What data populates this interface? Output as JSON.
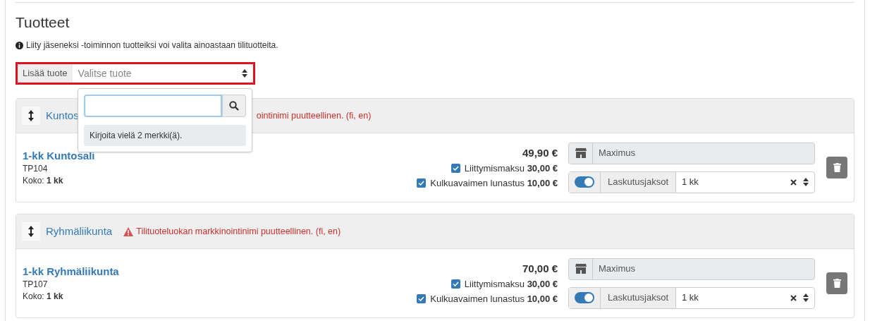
{
  "section": {
    "title": "Tuotteet",
    "info": "Liity jäseneksi -toiminnon tuotteiksi voi valita ainoastaan tilituotteita."
  },
  "add_product": {
    "label": "Lisää tuote",
    "placeholder": "Valitse tuote",
    "highlighted": true
  },
  "dropdown": {
    "message": "Kirjoita vielä 2 merkki(ä)."
  },
  "groups": [
    {
      "kind": "covered",
      "title": "Kuntos",
      "warning_icon": false,
      "warning": "ointinimi puutteellinen. (fi, en)",
      "product": {
        "name": "1-kk Kuntosali",
        "code": "TP104",
        "size": "Koko: **1 kk**",
        "price": "49,90 €",
        "extras": [
          {
            "text": "Liittymismaksu **30,00 €**",
            "checked": true
          },
          {
            "text": "Kulkuavaimen lunastus **10,00 €**",
            "checked": true
          }
        ],
        "location": "Maximus",
        "billing_on": true,
        "billing_label": "Laskutusjaksot",
        "billing_value": "1 kk"
      }
    },
    {
      "kind": "full",
      "title": "Ryhmäliikunta",
      "warning_icon": true,
      "warning": "Tilituoteluokan markkinointinimi puutteellinen. (fi, en)",
      "product": {
        "name": "1-kk Ryhmäliikunta",
        "code": "TP107",
        "size": "Koko: **1 kk**",
        "price": "70,00 €",
        "extras": [
          {
            "text": "Liittymismaksu **30,00 €**",
            "checked": true
          },
          {
            "text": "Kulkuavaimen lunastus **10,00 €**",
            "checked": true
          }
        ],
        "location": "Maximus",
        "billing_on": true,
        "billing_label": "Laskutusjaksot",
        "billing_value": "1 kk"
      }
    }
  ]
}
